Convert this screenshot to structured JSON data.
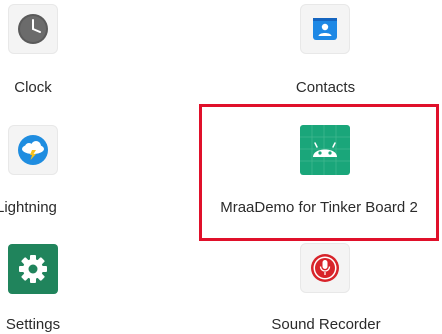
{
  "apps": [
    {
      "id": "clock",
      "label": "Clock",
      "icon": "clock-icon"
    },
    {
      "id": "contacts",
      "label": "Contacts",
      "icon": "contacts-icon"
    },
    {
      "id": "lightning",
      "label": "Lightning",
      "icon": "lightning-icon"
    },
    {
      "id": "mraademo",
      "label": "MraaDemo for Tinker Board 2",
      "icon": "android-robot-icon"
    },
    {
      "id": "settings",
      "label": "Settings",
      "icon": "gear-icon"
    },
    {
      "id": "sound-recorder",
      "label": "Sound Recorder",
      "icon": "microphone-icon"
    }
  ],
  "colors": {
    "highlight_border": "#e0102a",
    "contacts_blue": "#1e88e5",
    "mraademo_green": "#1aa67a",
    "settings_green": "#20845c",
    "recorder_red": "#d8232a",
    "lightning_blue": "#1f8de0"
  }
}
